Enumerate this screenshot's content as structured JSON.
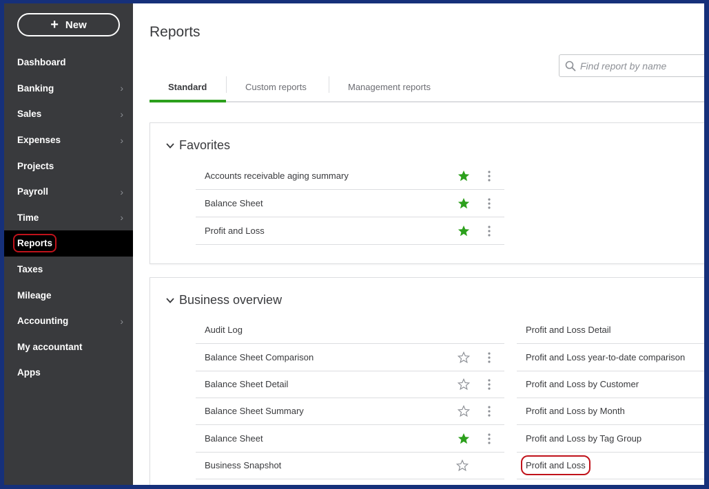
{
  "sidebar": {
    "new_button": "New",
    "items": [
      {
        "label": "Dashboard",
        "chevron": false
      },
      {
        "label": "Banking",
        "chevron": true
      },
      {
        "label": "Sales",
        "chevron": true
      },
      {
        "label": "Expenses",
        "chevron": true
      },
      {
        "label": "Projects",
        "chevron": false
      },
      {
        "label": "Payroll",
        "chevron": true
      },
      {
        "label": "Time",
        "chevron": true
      },
      {
        "label": "Reports",
        "chevron": false,
        "active": true
      },
      {
        "label": "Taxes",
        "chevron": false
      },
      {
        "label": "Mileage",
        "chevron": false
      },
      {
        "label": "Accounting",
        "chevron": true
      },
      {
        "label": "My accountant",
        "chevron": false
      },
      {
        "label": "Apps",
        "chevron": false
      }
    ]
  },
  "page": {
    "title": "Reports",
    "search_placeholder": "Find report by name"
  },
  "tabs": [
    {
      "label": "Standard",
      "active": true
    },
    {
      "label": "Custom reports",
      "active": false
    },
    {
      "label": "Management reports",
      "active": false
    }
  ],
  "favorites": {
    "title": "Favorites",
    "rows": [
      {
        "name": "Accounts receivable aging summary",
        "favorite": true
      },
      {
        "name": "Balance Sheet",
        "favorite": true
      },
      {
        "name": "Profit and Loss",
        "favorite": true
      }
    ]
  },
  "business_overview": {
    "title": "Business overview",
    "left": [
      {
        "name": "Audit Log",
        "favorite": null
      },
      {
        "name": "Balance Sheet Comparison",
        "favorite": false
      },
      {
        "name": "Balance Sheet Detail",
        "favorite": false
      },
      {
        "name": "Balance Sheet Summary",
        "favorite": false
      },
      {
        "name": "Balance Sheet",
        "favorite": true
      },
      {
        "name": "Business Snapshot",
        "favorite": false
      }
    ],
    "right": [
      {
        "name": "Profit and Loss Detail"
      },
      {
        "name": "Profit and Loss year-to-date comparison"
      },
      {
        "name": "Profit and Loss by Customer"
      },
      {
        "name": "Profit and Loss by Month"
      },
      {
        "name": "Profit and Loss by Tag Group"
      },
      {
        "name": "Profit and Loss",
        "highlighted": true
      }
    ]
  },
  "colors": {
    "sidebar_bg": "#393a3d",
    "active_bg": "#000000",
    "accent_green": "#2ca01c",
    "highlight_red": "#c0121a",
    "frame_blue": "#16307a"
  }
}
